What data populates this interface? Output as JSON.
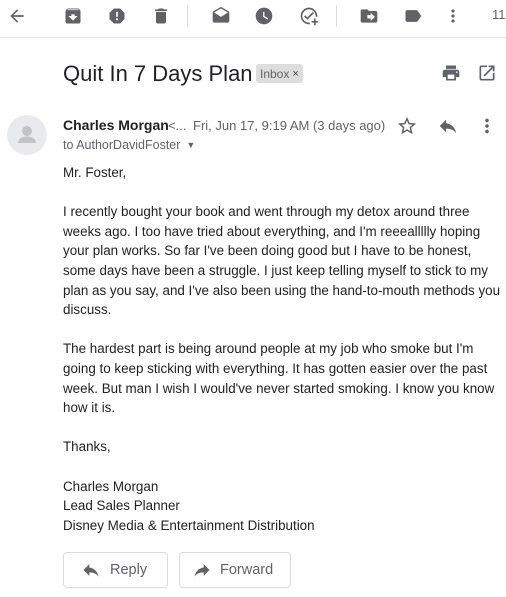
{
  "toolbar": {
    "icons": [
      "back-arrow-icon",
      "archive-icon",
      "report-spam-icon",
      "delete-icon",
      "mark-unread-icon",
      "snooze-icon",
      "add-to-tasks-icon",
      "move-to-icon",
      "labels-icon",
      "more-vert-icon"
    ],
    "page_count": "11"
  },
  "subject": {
    "title": "Quit In 7 Days Plan",
    "label": "Inbox",
    "label_remove": "×"
  },
  "message": {
    "sender_name": "Charles Morgan",
    "sender_email_truncated": "<...",
    "date": "Fri, Jun 17, 9:19 AM (3 days ago)",
    "to": "to AuthorDavidFoster",
    "body": {
      "greeting": "Mr. Foster,",
      "paragraph1": "I recently bought your book and went through my detox around three weeks ago. I too have tried about everything, and I'm reeeallllly hoping your plan works. So far I've been doing good but I have to be honest, some days have been a struggle. I just keep telling myself to stick to my plan as you say, and I've also been using the hand-to-mouth methods you discuss.",
      "paragraph2": "The hardest part is being around people at my job who smoke but I'm going to keep sticking with everything. It has gotten easier over the past week. But man I wish I would've never started smoking. I know you know how it is.",
      "closing": "Thanks,",
      "sig_name": "Charles Morgan",
      "sig_title": "Lead Sales Planner",
      "sig_company": "Disney Media & Entertainment Distribution"
    }
  },
  "actions": {
    "reply_label": "Reply",
    "forward_label": "Forward"
  },
  "colors": {
    "icon": "#5f6368",
    "text": "#202124",
    "chip_bg": "#dddddd",
    "border": "#dadce0"
  }
}
